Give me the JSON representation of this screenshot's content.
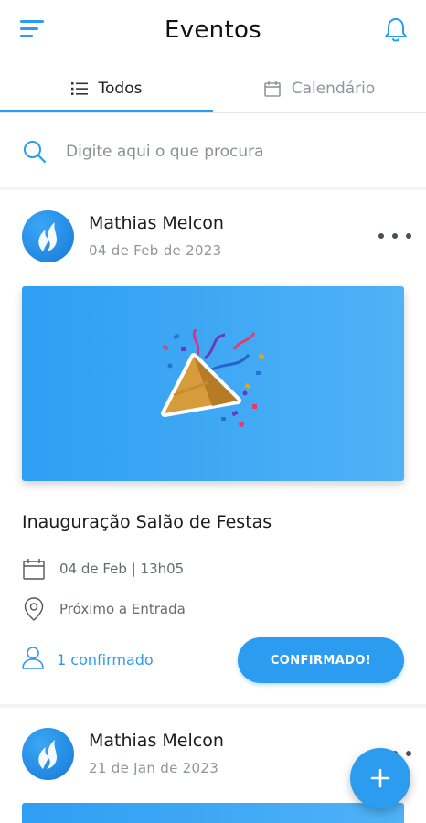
{
  "header": {
    "title": "Eventos",
    "menu_icon": "hamburger-menu-icon",
    "notification_icon": "bell-icon"
  },
  "tabs": [
    {
      "label": "Todos",
      "icon": "list-icon",
      "active": true
    },
    {
      "label": "Calendário",
      "icon": "calendar-icon",
      "active": false
    }
  ],
  "search": {
    "placeholder": "Digite aqui o que procura"
  },
  "events": [
    {
      "author": "Mathias Melcon",
      "posted_date": "04 de Feb de 2023",
      "image": "party-popper",
      "title": "Inauguração Salão de Festas",
      "schedule": "04 de Feb | 13h05",
      "location": "Próximo a Entrada",
      "confirmed_text": "1 confirmado",
      "confirm_button": "CONFIRMADO!"
    },
    {
      "author": "Mathias Melcon",
      "posted_date": "21 de Jan de 2023"
    }
  ],
  "fab": {
    "label": "+"
  },
  "colors": {
    "accent": "#2b9cf0",
    "text_primary": "#1b1b1b",
    "text_secondary": "#8f959c"
  }
}
